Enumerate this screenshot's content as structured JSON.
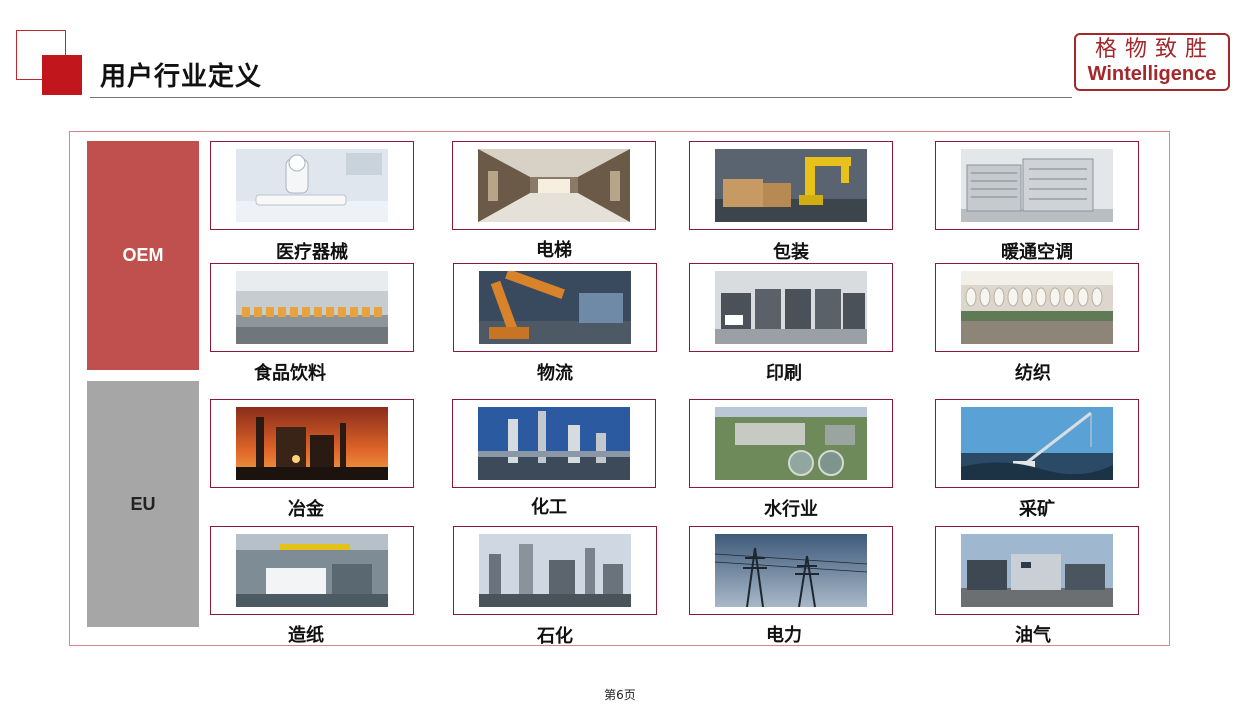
{
  "header": {
    "title": "用户行业定义",
    "logo_cn": "格物致胜",
    "logo_en": "Wintelligence"
  },
  "groups": {
    "oem": "OEM",
    "eu": "EU"
  },
  "tiles": [
    {
      "label": "医疗器械",
      "image": "medical-equipment-photo"
    },
    {
      "label": "电梯",
      "image": "elevator-lobby-photo"
    },
    {
      "label": "包装",
      "image": "packaging-robot-photo"
    },
    {
      "label": "暖通空调",
      "image": "hvac-units-photo"
    },
    {
      "label": "食品饮料",
      "image": "beverage-line-photo"
    },
    {
      "label": "物流",
      "image": "logistics-robot-photo"
    },
    {
      "label": "印刷",
      "image": "printing-press-photo"
    },
    {
      "label": "纺织",
      "image": "textile-machine-photo"
    },
    {
      "label": "冶金",
      "image": "steel-mill-photo"
    },
    {
      "label": "化工",
      "image": "chemical-plant-photo"
    },
    {
      "label": "水行业",
      "image": "water-treatment-photo"
    },
    {
      "label": "采矿",
      "image": "mining-crane-photo"
    },
    {
      "label": "造纸",
      "image": "paper-mill-photo"
    },
    {
      "label": "石化",
      "image": "petrochemical-plant-photo"
    },
    {
      "label": "电力",
      "image": "power-lines-photo"
    },
    {
      "label": "油气",
      "image": "oil-gas-facility-photo"
    }
  ],
  "footer": {
    "page": "第6页"
  }
}
